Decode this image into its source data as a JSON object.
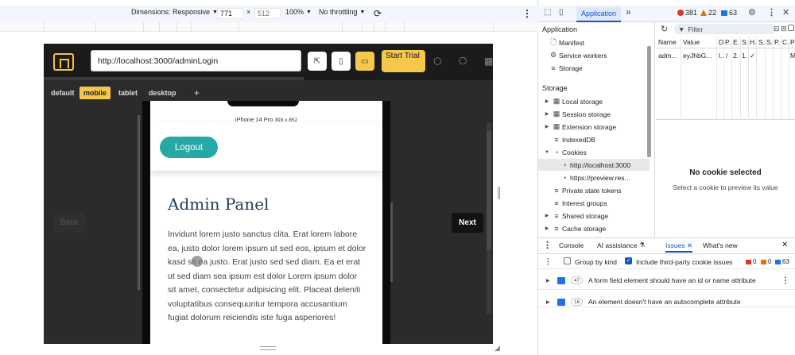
{
  "device_toolbar": {
    "dimensions_label": "Dimensions: Responsive",
    "width": "771",
    "times": "×",
    "height": "512",
    "zoom": "100%",
    "throttling": "No throttling"
  },
  "site": {
    "url": "http://localhost:3000/adminLogin",
    "start_trial": "Start Trial",
    "device_tabs": [
      "default",
      "mobile",
      "tablet",
      "desktop"
    ],
    "add_tab": "+",
    "device_name": "iPhone 14 Pro",
    "device_size": "393 x 852",
    "logout": "Logout",
    "page_title": "Admin Panel",
    "body_text": "Invidunt lorem justo sanctus clita. Erat lorem labore ea, justo dolor lorem ipsum ut sed eos, ipsum et dolor kasd sit ea justo. Erat justo sed sed diam. Ea et erat ut sed diam sea ipsum est dolor Lorem ipsum dolor sit amet, consectetur adipisicing elit. Placeat deleniti voluptatibus consequuntur tempora accusantium fugiat dolorum reiciendis iste fuga asperiores!",
    "back": "Back",
    "next": "Next"
  },
  "devtools": {
    "active_tab": "Application",
    "more_tabs": "»",
    "errors": "381",
    "warnings": "22",
    "info": "63",
    "sidebar": {
      "application_title": "Application",
      "application_items": [
        "Manifest",
        "Service workers",
        "Storage"
      ],
      "storage_title": "Storage",
      "storage_items": [
        "Local storage",
        "Session storage",
        "Extension storage",
        "IndexedDB",
        "Cookies",
        "http://localhost:3000",
        "https://preview.res...",
        "Private state tokens",
        "Interest groups",
        "Shared storage",
        "Cache storage"
      ]
    },
    "filter_placeholder": "Filter",
    "cookie_columns": [
      "Name",
      "Value",
      "D",
      "P.",
      "E.",
      "S.",
      "H.",
      "S.",
      "S.",
      "P.",
      "C.",
      "P"
    ],
    "cookie_row": [
      "adm...",
      "eyJhbG...",
      "l..",
      "/",
      "2.",
      "1.",
      "✓",
      "M"
    ],
    "no_cookie_title": "No cookie selected",
    "no_cookie_sub": "Select a cookie to preview its value",
    "drawer": {
      "tabs": [
        "Console",
        "AI assistance",
        "Issues",
        "What's new"
      ],
      "group_by_kind": "Group by kind",
      "include_third_party": "Include third-party cookie issues",
      "count_red": "0",
      "count_orange": "0",
      "count_blue": "63",
      "issues": [
        {
          "count": "47",
          "text": "A form field element should have an id or name attribute"
        },
        {
          "count": "16",
          "text": "An element doesn't have an autocomplete attribute"
        }
      ]
    }
  },
  "colors": {
    "accent_yellow": "#f5c84b",
    "logout_teal": "#26a9a4",
    "title_navy": "#1c3d5a",
    "devtools_blue": "#0b57d0"
  }
}
